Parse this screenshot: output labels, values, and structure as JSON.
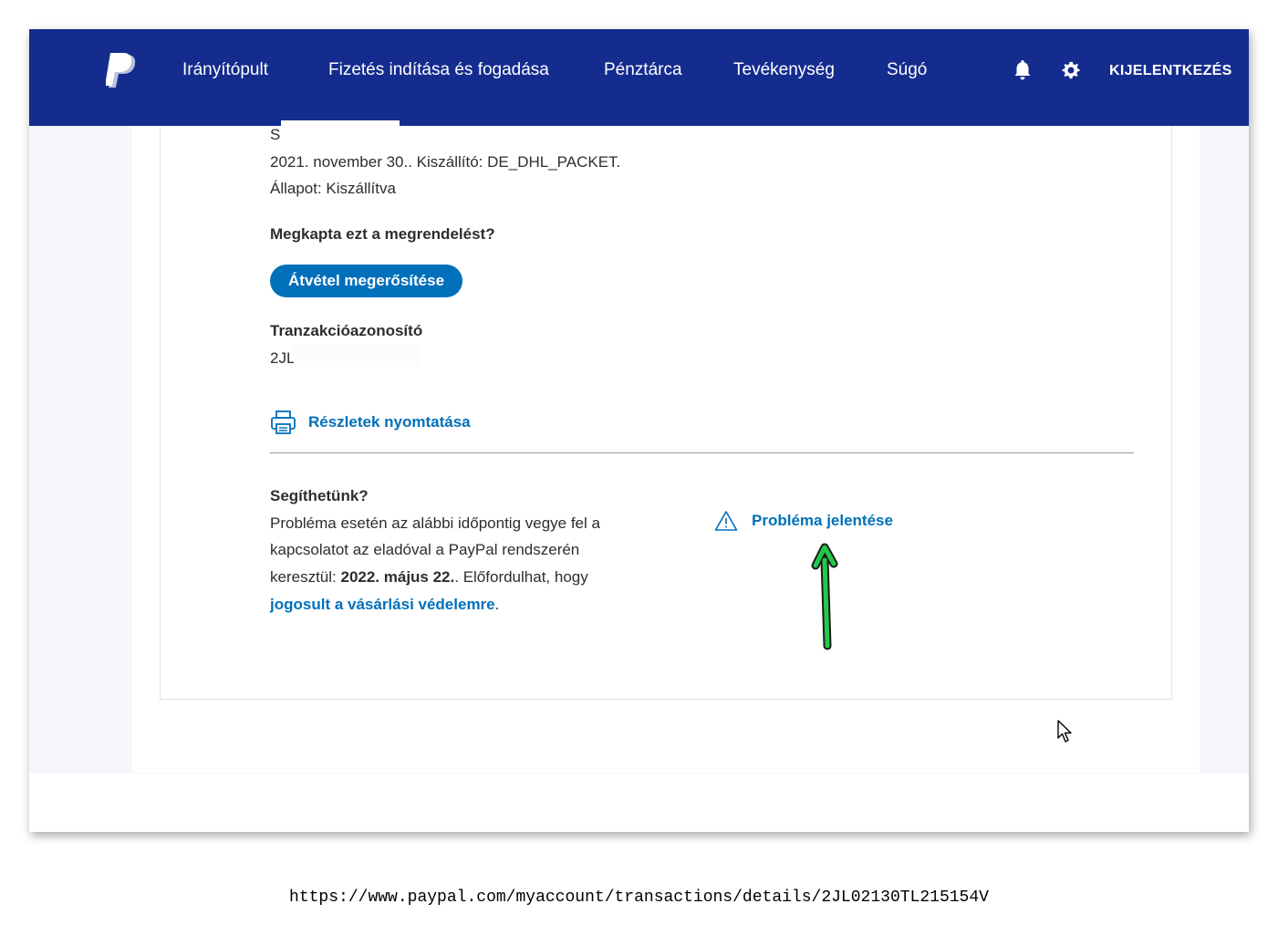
{
  "nav": {
    "items": [
      "Irányítópult",
      "Fizetés indítása és fogadása",
      "Pénztárca",
      "Tevékenység",
      "Súgó"
    ],
    "logout_label": "KIJELENTKEZÉS",
    "icons": [
      "paypal-logo",
      "bell-icon",
      "gear-icon"
    ]
  },
  "shipping": {
    "partial_line": "S",
    "date_carrier": "2021. november 30.. Kiszállító: DE_DHL_PACKET.",
    "status": "Állapot: Kiszállítva"
  },
  "receipt": {
    "question": "Megkapta ezt a megrendelést?",
    "confirm_button": "Átvétel megerősítése"
  },
  "transaction": {
    "heading": "Tranzakcióazonosító",
    "id_partial": "2JL"
  },
  "print": {
    "label": "Részletek nyomtatása"
  },
  "help": {
    "heading": "Segíthetünk?",
    "line1": "Probléma esetén az alábbi időpontig vegye fel a",
    "line2": "kapcsolatot az eladóval a PayPal rendszerén",
    "line3_prefix": "keresztül: ",
    "deadline": "2022. május 22.",
    "line3_suffix": ". Előfordulhat, hogy",
    "protection_link": "jogosult a vásárlási védelemre",
    "period": "."
  },
  "report": {
    "label": "Probléma jelentése"
  },
  "caption_url": "https://www.paypal.com/myaccount/transactions/details/2JL02130TL215154V",
  "colors": {
    "nav_bg": "#142c8e",
    "primary": "#0070ba",
    "annotation_arrow": "#22c94a"
  }
}
